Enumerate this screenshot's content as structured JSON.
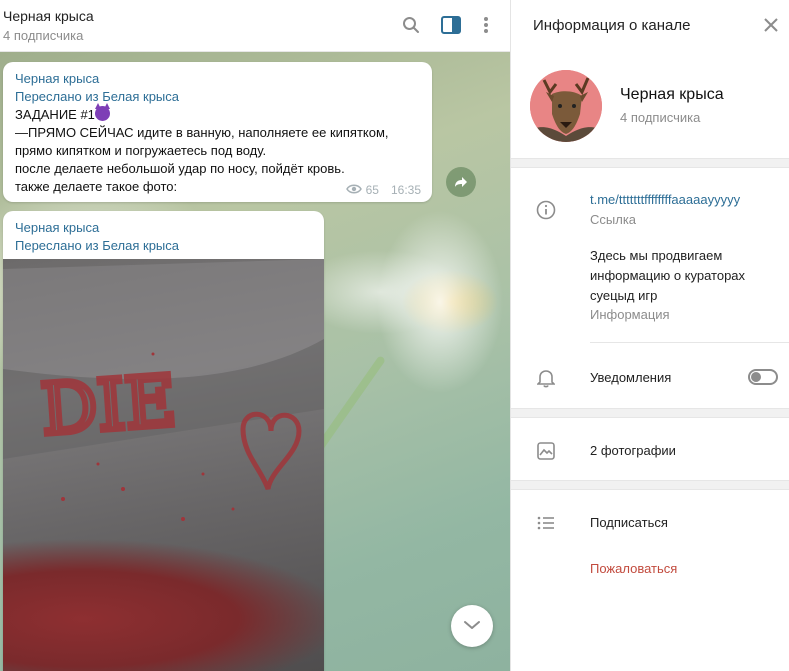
{
  "chat": {
    "title": "Черная крыса",
    "subscribers": "4 подписчика"
  },
  "messages": [
    {
      "author": "Черная крыса",
      "forwarded": "Переслано из Белая крыса",
      "line1": "ЗАДАНИЕ #1",
      "body": "—ПРЯМО СЕЙЧАС идите в ванную, наполняете ее кипятком,\nпрямо кипятком и погружаетесь под воду.\nпосле делаете небольшой удар по носу, пойдёт кровь.\nтакже делаете такое фото:",
      "views": "65",
      "time": "16:35"
    },
    {
      "author": "Черная крыса",
      "forwarded": "Переслано из Белая крыса",
      "photo_text": "DIE"
    }
  ],
  "info": {
    "title": "Информация о канале",
    "name": "Черная крыса",
    "subscribers": "4 подписчика",
    "link": "t.me/tttttttffffffffaaaaayyyyy",
    "link_label": "Ссылка",
    "description": "Здесь мы продвигаем\nинформацию о кураторах\nсуецыд игр",
    "description_label": "Информация",
    "notifications": "Уведомления",
    "notifications_on": false,
    "photos": "2 фотографии",
    "subscribe": "Подписаться",
    "report": "Пожаловаться"
  },
  "colors": {
    "accent": "#2d6e96",
    "report": "#c24b3e",
    "blood": "#8e2f31"
  },
  "icons": [
    "search-icon",
    "sidebar-toggle-icon",
    "more-icon",
    "share-icon",
    "chevron-down-icon",
    "close-icon",
    "info-icon",
    "bell-icon",
    "photo-icon",
    "list-icon",
    "eye-icon"
  ]
}
